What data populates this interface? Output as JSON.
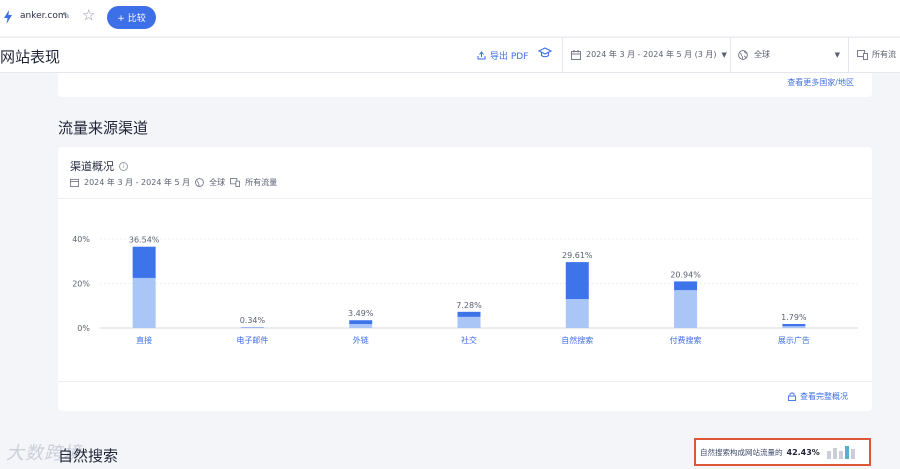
{
  "topbar": {
    "domain": "anker.com",
    "compare_label": "+ 比较"
  },
  "header": {
    "page_title": "网站表现",
    "export_label": "导出 PDF",
    "date_range": "2024 年 3 月 - 2024 年 5 月 (3 月)",
    "region": "全球",
    "traffic": "所有流"
  },
  "top_card": {
    "more_regions_link": "查看更多国家/地区"
  },
  "section": {
    "title": "流量来源渠道"
  },
  "channel_card": {
    "title": "渠道概况",
    "meta_date": "2024 年 3 月 - 2024 年 5 月",
    "meta_region": "全球",
    "meta_traffic": "所有流量",
    "full_overview_link": "查看完整概况"
  },
  "chart_data": {
    "type": "bar",
    "categories": [
      "直接",
      "电子邮件",
      "外链",
      "社交",
      "自然搜索",
      "付费搜索",
      "展示广告"
    ],
    "value_labels": [
      "36.54%",
      "0.34%",
      "3.49%",
      "7.28%",
      "29.61%",
      "20.94%",
      "1.79%"
    ],
    "series": [
      {
        "values": [
          22.5,
          0.2,
          1.8,
          5.0,
          13.0,
          17.0,
          0.8
        ]
      },
      {
        "values": [
          14.04,
          0.14,
          1.69,
          2.28,
          16.61,
          3.94,
          0.99
        ]
      }
    ],
    "ylim": [
      0,
      40
    ],
    "yticks": [
      0,
      20,
      40
    ],
    "ytick_labels": [
      "0%",
      "20%",
      "40%"
    ],
    "grid": true,
    "colors": {
      "light": "#a9c6f7",
      "dark": "#3d74ea"
    }
  },
  "bottom": {
    "section_title": "自然搜索",
    "watermark": "大数跨境",
    "highlight_text": "自然搜索构成网站流量的",
    "highlight_value": "42.43%",
    "spark": [
      0.55,
      0.75,
      0.6,
      0.95,
      0.7
    ]
  },
  "colors": {
    "accent": "#3d6fe8",
    "highlight_border": "#e0563b"
  }
}
